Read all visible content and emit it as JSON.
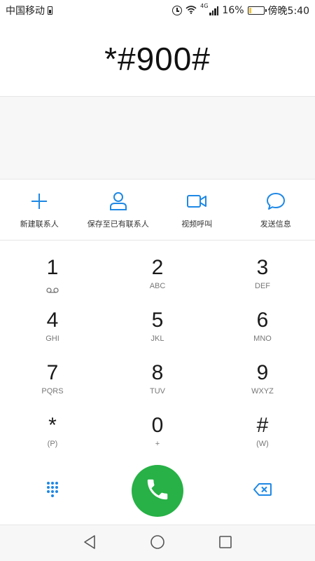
{
  "status_bar": {
    "carrier": "中国移动",
    "sim_icon": "sim-card-icon",
    "alarm_icon": "alarm-icon",
    "wifi_icon": "wifi-icon",
    "network_type": "4G",
    "signal_icon": "signal-icon",
    "battery_percent": "16%",
    "battery_level": 0.16,
    "battery_color": "#f3c23b",
    "time": "傍晚5:40"
  },
  "dialer": {
    "number": "*#900#"
  },
  "actions": [
    {
      "label": "新建联系人",
      "icon": "add-icon"
    },
    {
      "label": "保存至已有联系人",
      "icon": "person-icon"
    },
    {
      "label": "视频呼叫",
      "icon": "video-camera-icon"
    },
    {
      "label": "发送信息",
      "icon": "message-bubble-icon"
    }
  ],
  "keypad": {
    "keys": [
      {
        "digit": "1",
        "sub": ""
      },
      {
        "digit": "2",
        "sub": "ABC"
      },
      {
        "digit": "3",
        "sub": "DEF"
      },
      {
        "digit": "4",
        "sub": "GHI"
      },
      {
        "digit": "5",
        "sub": "JKL"
      },
      {
        "digit": "6",
        "sub": "MNO"
      },
      {
        "digit": "7",
        "sub": "PQRS"
      },
      {
        "digit": "8",
        "sub": "TUV"
      },
      {
        "digit": "9",
        "sub": "WXYZ"
      },
      {
        "digit": "*",
        "sub": "(P)"
      },
      {
        "digit": "0",
        "sub": "+"
      },
      {
        "digit": "#",
        "sub": "(W)"
      }
    ]
  },
  "controls": {
    "dialpad_toggle_icon": "dialpad-icon",
    "call_icon": "phone-icon",
    "backspace_icon": "backspace-icon"
  },
  "colors": {
    "accent": "#1e88e5",
    "call_green": "#27b146"
  },
  "nav": {
    "back_icon": "back-triangle-icon",
    "home_icon": "home-circle-icon",
    "recents_icon": "recents-square-icon"
  }
}
